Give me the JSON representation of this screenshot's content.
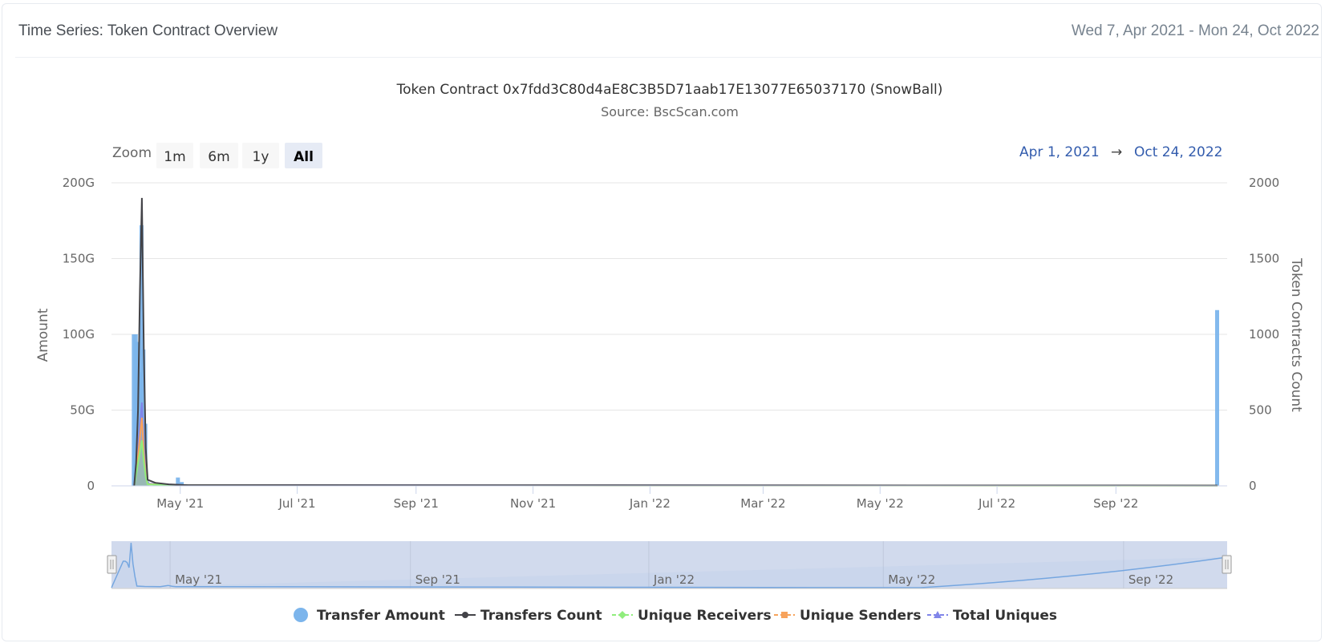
{
  "header": {
    "title": "Time Series: Token Contract Overview",
    "date_range": "Wed 7, Apr 2021 - Mon 24, Oct 2022"
  },
  "toolbar": {
    "zoom_label": "Zoom",
    "zoom_buttons": [
      "1m",
      "6m",
      "1y",
      "All"
    ],
    "selected": "All",
    "range_from": "Apr 1, 2021",
    "range_arrow": "→",
    "range_to": "Oct 24, 2022"
  },
  "colors": {
    "transfer_amount": "#7cb5ec",
    "transfers_count": "#434348",
    "unique_receivers": "#90ed7d",
    "unique_senders": "#f7a35c",
    "total_uniques": "#8085e9",
    "navigator_mask": "#ccd6eb"
  },
  "chart_data": {
    "type": "line",
    "title": "Token Contract 0x7fdd3C80d4aE8C3B5D71aab17E13077E65037170 (SnowBall)",
    "subtitle": "Source: BscScan.com",
    "ylabel": "Amount",
    "ylabel_right": "Token Contracts Count",
    "ylim": [
      0,
      200
    ],
    "ylim_right": [
      0,
      2000
    ],
    "y_ticks": [
      "0",
      "50G",
      "100G",
      "150G",
      "200G"
    ],
    "y_ticks_right": [
      "0",
      "500",
      "1000",
      "1500",
      "2000"
    ],
    "x_range": [
      "2021-04-01",
      "2022-10-24"
    ],
    "x_ticks": [
      {
        "date": "2021-05-01",
        "label": "May '21"
      },
      {
        "date": "2021-07-01",
        "label": "Jul '21"
      },
      {
        "date": "2021-09-01",
        "label": "Sep '21"
      },
      {
        "date": "2021-11-01",
        "label": "Nov '21"
      },
      {
        "date": "2022-01-01",
        "label": "Jan '22"
      },
      {
        "date": "2022-03-01",
        "label": "Mar '22"
      },
      {
        "date": "2022-05-01",
        "label": "May '22"
      },
      {
        "date": "2022-07-01",
        "label": "Jul '22"
      },
      {
        "date": "2022-09-01",
        "label": "Sep '22"
      }
    ],
    "navigator_ticks": [
      {
        "date": "2021-05-01",
        "label": "May '21"
      },
      {
        "date": "2021-09-01",
        "label": "Sep '21"
      },
      {
        "date": "2022-01-01",
        "label": "Jan '22"
      },
      {
        "date": "2022-05-01",
        "label": "May '22"
      },
      {
        "date": "2022-09-01",
        "label": "Sep '22"
      }
    ],
    "grid": true,
    "legend_position": "bottom",
    "series": [
      {
        "name": "Transfer Amount",
        "type": "column",
        "axis": "left",
        "unit": "G",
        "points": [
          [
            "2021-04-07",
            100
          ],
          [
            "2021-04-08",
            100
          ],
          [
            "2021-04-09",
            95
          ],
          [
            "2021-04-10",
            75
          ],
          [
            "2021-04-11",
            172
          ],
          [
            "2021-04-12",
            90
          ],
          [
            "2021-04-13",
            41
          ],
          [
            "2021-04-14",
            3
          ],
          [
            "2021-04-18",
            1.5
          ],
          [
            "2021-04-22",
            1.2
          ],
          [
            "2021-04-26",
            1.0
          ],
          [
            "2021-04-30",
            5.5
          ],
          [
            "2021-05-02",
            2.5
          ],
          [
            "2021-05-04",
            1.0
          ],
          [
            "2022-10-24",
            116
          ]
        ]
      },
      {
        "name": "Transfers Count",
        "type": "line",
        "axis": "right",
        "points": [
          [
            "2021-04-07",
            0
          ],
          [
            "2021-04-08",
            150
          ],
          [
            "2021-04-09",
            500
          ],
          [
            "2021-04-10",
            1300
          ],
          [
            "2021-04-11",
            1900
          ],
          [
            "2021-04-12",
            900
          ],
          [
            "2021-04-13",
            250
          ],
          [
            "2021-04-14",
            40
          ],
          [
            "2021-04-18",
            20
          ],
          [
            "2021-04-25",
            10
          ],
          [
            "2021-05-05",
            5
          ],
          [
            "2022-10-24",
            2
          ]
        ]
      },
      {
        "name": "Unique Receivers",
        "type": "line",
        "axis": "right",
        "points": [
          [
            "2021-04-07",
            0
          ],
          [
            "2021-04-09",
            150
          ],
          [
            "2021-04-11",
            300
          ],
          [
            "2021-04-12",
            160
          ],
          [
            "2021-04-13",
            60
          ],
          [
            "2021-04-14",
            10
          ],
          [
            "2021-05-05",
            3
          ],
          [
            "2022-10-24",
            1
          ]
        ]
      },
      {
        "name": "Unique Senders",
        "type": "line",
        "axis": "right",
        "points": [
          [
            "2021-04-07",
            0
          ],
          [
            "2021-04-09",
            200
          ],
          [
            "2021-04-11",
            450
          ],
          [
            "2021-04-12",
            220
          ],
          [
            "2021-04-13",
            70
          ],
          [
            "2021-04-14",
            12
          ],
          [
            "2021-05-05",
            3
          ],
          [
            "2022-10-24",
            1
          ]
        ]
      },
      {
        "name": "Total Uniques",
        "type": "line",
        "axis": "right",
        "points": [
          [
            "2021-04-07",
            0
          ],
          [
            "2021-04-09",
            260
          ],
          [
            "2021-04-11",
            550
          ],
          [
            "2021-04-12",
            280
          ],
          [
            "2021-04-13",
            90
          ],
          [
            "2021-04-14",
            15
          ],
          [
            "2021-05-05",
            4
          ],
          [
            "2022-10-24",
            2
          ]
        ]
      }
    ]
  }
}
